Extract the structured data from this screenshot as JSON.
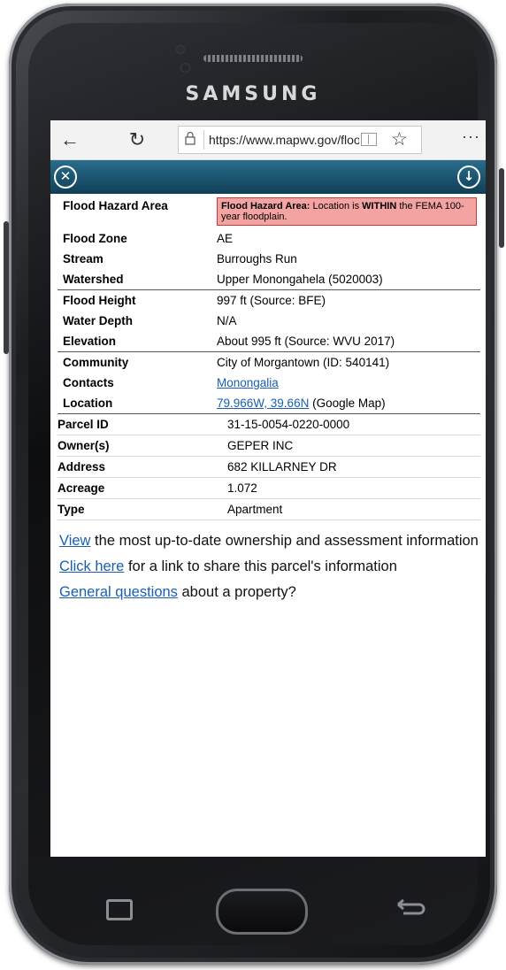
{
  "device": {
    "brand": "SAMSUNG"
  },
  "browser": {
    "url": "https://www.mapwv.gov/flood/map/",
    "back_icon": "←",
    "refresh_icon": "↻",
    "lock_icon": "🔒",
    "star_icon": "☆",
    "more_icon": "···"
  },
  "appbar": {
    "close_icon": "✕",
    "download_icon": "↓",
    "color": "#1b5573"
  },
  "flood": {
    "hazard_label": "Flood Hazard Area",
    "hazard_prefix": "Flood Hazard Area:",
    "hazard_text_a": " Location is ",
    "hazard_within": "WITHIN",
    "hazard_text_b": " the FEMA 100-year floodplain.",
    "rows_group1": [
      {
        "label": "Flood Zone",
        "value": "AE"
      },
      {
        "label": "Stream",
        "value": "Burroughs Run"
      },
      {
        "label": "Watershed",
        "value": "Upper Monongahela (5020003)"
      }
    ],
    "rows_group2": [
      {
        "label": "Flood Height",
        "value": "997 ft (Source: BFE)"
      },
      {
        "label": "Water Depth",
        "value": "N/A"
      },
      {
        "label": "Elevation",
        "value": "About 995 ft (Source: WVU 2017)"
      }
    ],
    "community_label": "Community",
    "community_value": "City of Morgantown (ID: 540141)",
    "contacts_label": "Contacts",
    "contacts_link": "Monongalia",
    "location_label": "Location",
    "location_link": "79.966W, 39.66N",
    "location_suffix": " (Google Map)"
  },
  "parcel": [
    {
      "label": "Parcel ID",
      "value": "31-15-0054-0220-0000"
    },
    {
      "label": "Owner(s)",
      "value": "GEPER INC"
    },
    {
      "label": "Address",
      "value": "682 KILLARNEY DR"
    },
    {
      "label": "Acreage",
      "value": "1.072"
    },
    {
      "label": "Type",
      "value": "Apartment"
    }
  ],
  "links": {
    "view_link": "View",
    "view_text": " the most up-to-date ownership and assessment information",
    "share_link": "Click here",
    "share_text": " for a link to share this parcel's information",
    "questions_link": "General questions",
    "questions_text": " about a property?"
  }
}
